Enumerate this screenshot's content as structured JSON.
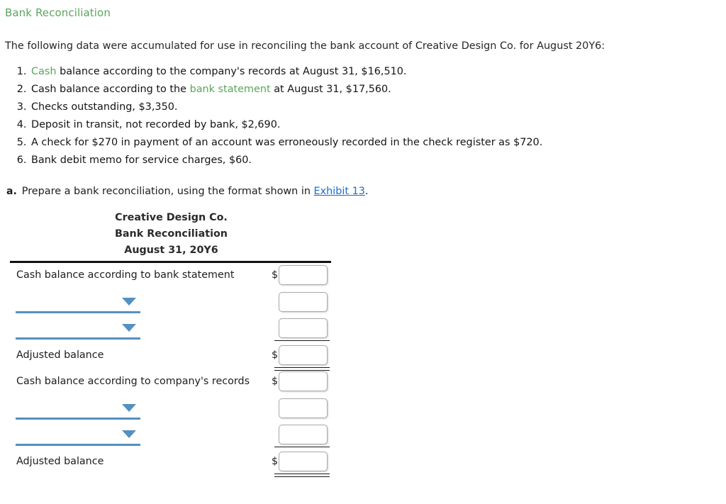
{
  "question": {
    "title": "Bank Reconciliation",
    "intro": "The following data were accumulated for use in reconciling the bank account of Creative Design Co. for August 20Y6:",
    "facts": [
      {
        "pre": "",
        "highlight": "Cash",
        "post": " balance according to the company's records at August 31, $16,510."
      },
      {
        "pre": "Cash balance according to the ",
        "highlight": "bank statement",
        "post": " at August 31, $17,560."
      },
      {
        "pre": "Checks outstanding, $3,350.",
        "highlight": "",
        "post": ""
      },
      {
        "pre": "Deposit in transit, not recorded by bank, $2,690.",
        "highlight": "",
        "post": ""
      },
      {
        "pre": "A check for $270 in payment of an account was erroneously recorded in the check register as $720.",
        "highlight": "",
        "post": ""
      },
      {
        "pre": "Bank debit memo for service charges, $60.",
        "highlight": "",
        "post": ""
      }
    ],
    "part_a": {
      "marker": "a.",
      "pre": "Prepare a bank reconciliation, using the format shown in ",
      "link": "Exhibit 13",
      "post": "."
    }
  },
  "statement": {
    "heading_line1": "Creative Design Co.",
    "heading_line2": "Bank Reconciliation",
    "heading_line3": "August 31, 20Y6",
    "rows": [
      {
        "kind": "label",
        "label": "Cash balance according to bank statement",
        "dollar": "$",
        "value": "",
        "placeholder": "",
        "rule": "none"
      },
      {
        "kind": "select",
        "label": "",
        "selected": "",
        "dollar": "",
        "value": "",
        "placeholder": "",
        "rule": "none"
      },
      {
        "kind": "select",
        "label": "",
        "selected": "",
        "dollar": "",
        "value": "",
        "placeholder": "",
        "rule": "single"
      },
      {
        "kind": "label",
        "label": "Adjusted balance",
        "dollar": "$",
        "value": "",
        "placeholder": "",
        "rule": "double"
      },
      {
        "kind": "label",
        "label": "Cash balance according to company's records",
        "dollar": "$",
        "value": "",
        "placeholder": "",
        "rule": "none"
      },
      {
        "kind": "select",
        "label": "",
        "selected": "",
        "dollar": "",
        "value": "",
        "placeholder": "",
        "rule": "none"
      },
      {
        "kind": "select",
        "label": "",
        "selected": "",
        "dollar": "",
        "value": "",
        "placeholder": "",
        "rule": "single"
      },
      {
        "kind": "label",
        "label": "Adjusted balance",
        "dollar": "$",
        "value": "",
        "placeholder": "",
        "rule": "double"
      }
    ]
  },
  "colors": {
    "accent_green": "#5aa65a",
    "link_blue": "#1a6ec8",
    "select_blue": "#5490c0",
    "rule_black": "#111111"
  }
}
